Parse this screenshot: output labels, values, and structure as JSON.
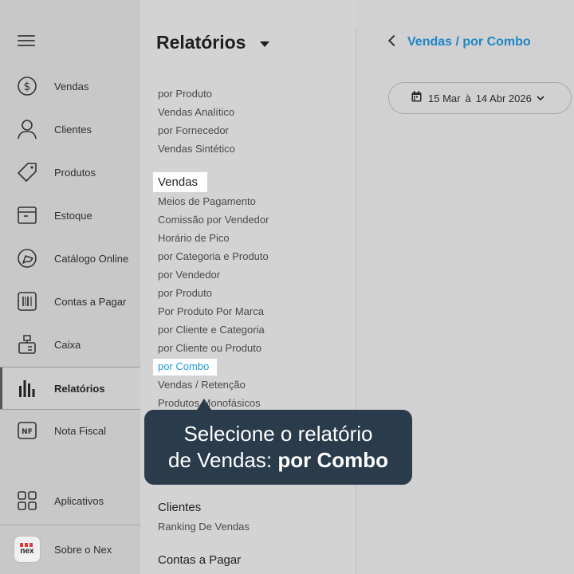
{
  "sidebar": {
    "items": [
      {
        "label": "Vendas",
        "icon": "dollar-circle-icon"
      },
      {
        "label": "Clientes",
        "icon": "user-icon"
      },
      {
        "label": "Produtos",
        "icon": "tag-icon"
      },
      {
        "label": "Estoque",
        "icon": "box-icon"
      },
      {
        "label": "Catálogo Online",
        "icon": "catalog-icon"
      },
      {
        "label": "Contas a Pagar",
        "icon": "barcode-icon"
      },
      {
        "label": "Caixa",
        "icon": "register-icon"
      },
      {
        "label": "Relatórios",
        "icon": "bar-chart-icon",
        "active": true
      },
      {
        "label": "Nota Fiscal",
        "icon": "nf-icon"
      }
    ],
    "nf_badge": "NF",
    "apps_label": "Aplicativos",
    "about_label": "Sobre o Nex",
    "logo_text": "nex"
  },
  "reports": {
    "title": "Relatórios",
    "top_links": [
      "por Produto",
      "Vendas Analítico",
      "por Fornecedor",
      "Vendas Sintético"
    ],
    "vendas_heading": "Vendas",
    "vendas_links": [
      "Meios de Pagamento",
      "Comissão por Vendedor",
      "Horário de Pico",
      "por Categoria e Produto",
      "por Vendedor",
      "por Produto",
      "Por Produto Por Marca",
      "por Cliente e Categoria",
      "por Cliente ou Produto",
      "por Combo",
      "Vendas / Retenção",
      "Produtos Monofásicos"
    ],
    "clientes_heading": "Clientes",
    "clientes_links": [
      "Ranking De Vendas"
    ],
    "contas_heading": "Contas a Pagar"
  },
  "tooltip": {
    "line1": "Selecione o relatório",
    "line2_prefix": "de Vendas: ",
    "line2_bold": "por Combo"
  },
  "breadcrumb": "Vendas / por Combo",
  "date_range": {
    "from": "15 Mar",
    "sep": "à",
    "to": "14 Abr 2026"
  },
  "colors": {
    "accent": "#1e86c6",
    "tooltip_bg": "#2a3b4b",
    "logo_red": "#e03a3a"
  }
}
